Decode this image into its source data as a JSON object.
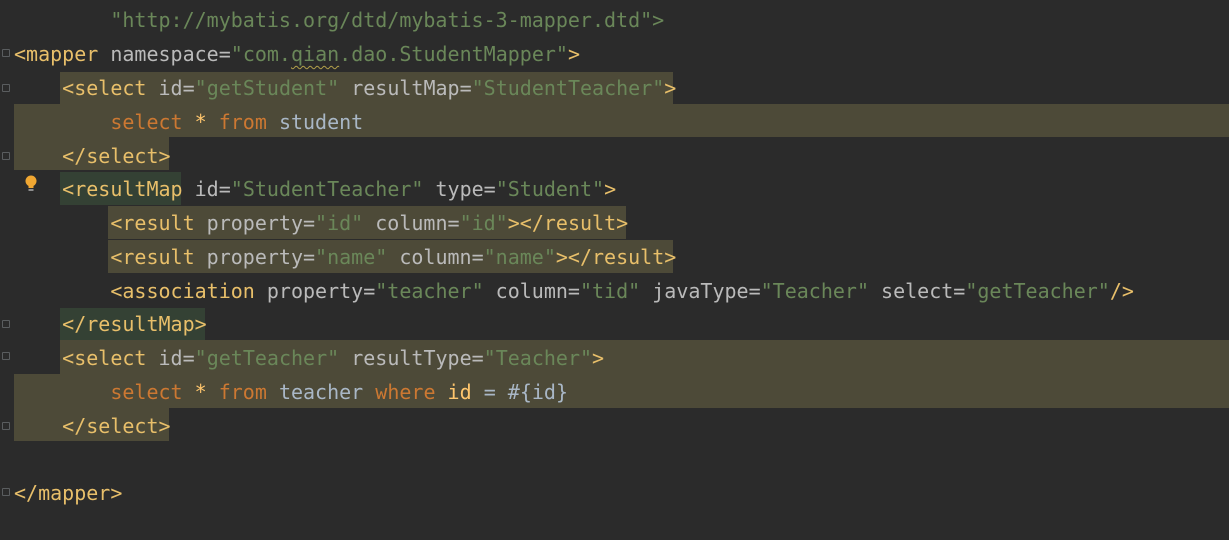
{
  "editor": {
    "language": "XML",
    "lines": [
      {
        "id": "l1",
        "text_dtd": "\"http://mybatis.org/dtd/mybatis-3-mapper.dtd\">"
      },
      {
        "id": "l2",
        "open": "<mapper",
        "attr": "namespace",
        "eq": "=",
        "q1": "\"",
        "ns1": "com.",
        "ns_squiggle": "qian",
        "ns2": ".dao.StudentMapper",
        "q2": "\"",
        "close": ">"
      },
      {
        "id": "l3",
        "open": "<select",
        "attr1": "id",
        "val1": "\"getStudent\"",
        "attr2": "resultMap",
        "val2": "\"StudentTeacher\"",
        "close": ">"
      },
      {
        "id": "l4",
        "kw1": "select",
        "star": "*",
        "kw2": "from",
        "table": "student"
      },
      {
        "id": "l5",
        "tag": "</select>"
      },
      {
        "id": "l6",
        "open": "<resultMap",
        "attr1": "id",
        "val1": "\"StudentTeacher\"",
        "attr2": "type",
        "val2": "\"Student\"",
        "close": ">"
      },
      {
        "id": "l7",
        "open": "<result",
        "attr1": "property",
        "val1": "\"id\"",
        "attr2": "column",
        "val2": "\"id\"",
        "close": "></result>"
      },
      {
        "id": "l8",
        "open": "<result",
        "attr1": "property",
        "val1": "\"name\"",
        "attr2": "column",
        "val2": "\"name\"",
        "close": "></result>"
      },
      {
        "id": "l9",
        "open": "<association",
        "attr1": "property",
        "val1": "\"teacher\"",
        "attr2": "column",
        "val2": "\"tid\"",
        "attr3": "javaType",
        "val3": "\"Teacher\"",
        "attr4": "select",
        "val4": "\"getTeacher\"",
        "close": "/>"
      },
      {
        "id": "l10",
        "tag": "</resultMap>"
      },
      {
        "id": "l11",
        "open": "<select",
        "attr1": "id",
        "val1": "\"getTeacher\"",
        "attr2": "resultType",
        "val2": "\"Teacher\"",
        "close": ">"
      },
      {
        "id": "l12",
        "kw1": "select",
        "star": "*",
        "kw2": "from",
        "table": "teacher",
        "kw3": "where",
        "col": "id",
        "op": "=",
        "param": "#{id}"
      },
      {
        "id": "l13",
        "tag": "</select>"
      },
      {
        "id": "l14"
      },
      {
        "id": "l15",
        "tag": "</mapper>"
      }
    ]
  },
  "colors": {
    "background": "#2b2b2b",
    "tag": "#e8bf6a",
    "attribute": "#bababa",
    "string": "#6a8759",
    "keyword": "#cc7832",
    "text": "#a9b7c6",
    "highlight_block": "#4d4a38",
    "highlight_tag": "#344134"
  },
  "icons": [
    "intention-bulb-icon",
    "fold-marker-icon"
  ]
}
